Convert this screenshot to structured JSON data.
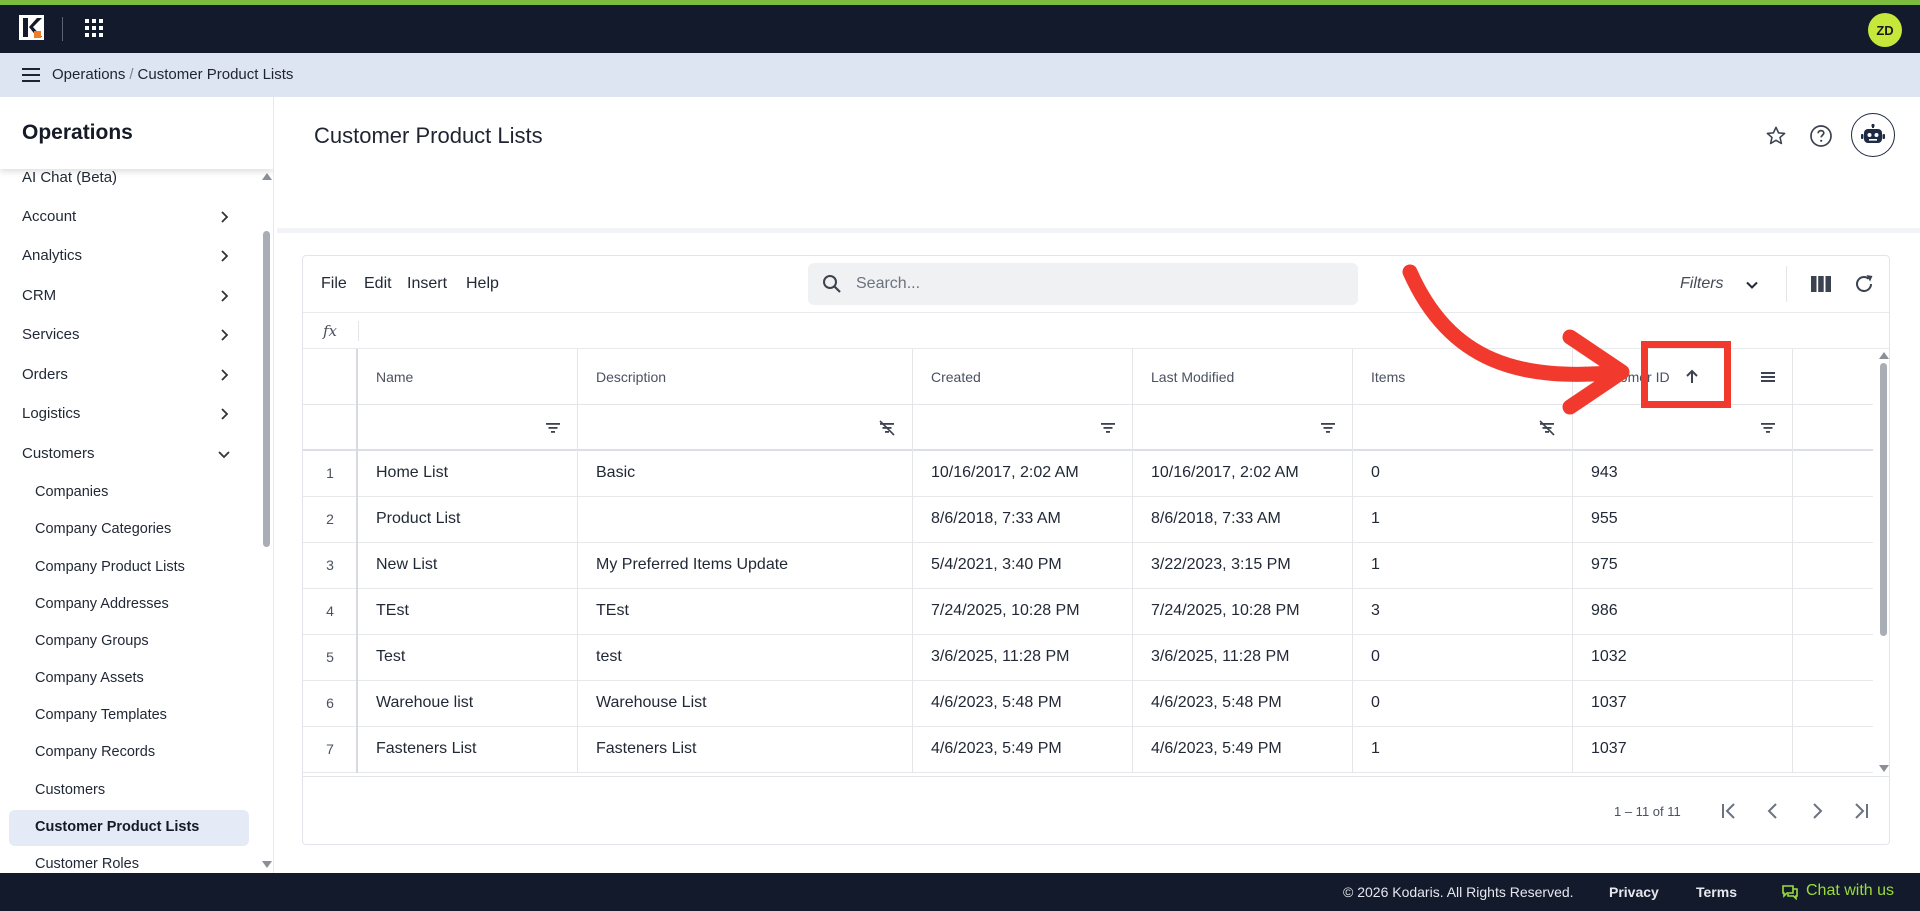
{
  "topbar": {
    "avatar_initials": "ZD",
    "accent": "#7dbb3f"
  },
  "breadcrumb": {
    "items": [
      "Operations",
      "Customer Product Lists"
    ]
  },
  "sidebar": {
    "title": "Operations",
    "items": [
      {
        "label": "AI Chat (Beta)"
      },
      {
        "label": "Account"
      },
      {
        "label": "Analytics"
      },
      {
        "label": "CRM"
      },
      {
        "label": "Services"
      },
      {
        "label": "Orders"
      },
      {
        "label": "Logistics"
      },
      {
        "label": "Customers"
      }
    ],
    "sub_items": [
      {
        "label": "Companies"
      },
      {
        "label": "Company Categories"
      },
      {
        "label": "Company Product Lists"
      },
      {
        "label": "Company Addresses"
      },
      {
        "label": "Company Groups"
      },
      {
        "label": "Company Assets"
      },
      {
        "label": "Company Templates"
      },
      {
        "label": "Company Records"
      },
      {
        "label": "Customers"
      },
      {
        "label": "Customer Product Lists"
      },
      {
        "label": "Customer Roles"
      }
    ]
  },
  "page": {
    "title": "Customer Product Lists"
  },
  "toolbar": {
    "menus": [
      "File",
      "Edit",
      "Insert",
      "Help"
    ],
    "search_placeholder": "Search...",
    "filters_label": "Filters",
    "fx_label": "fx"
  },
  "table": {
    "columns": [
      "Name",
      "Description",
      "Created",
      "Last Modified",
      "Items",
      "Customer ID"
    ],
    "sorted_column": "Customer ID",
    "sort_direction": "ascending",
    "rows": [
      [
        "1",
        "Home List",
        "Basic",
        "10/16/2017, 2:02 AM",
        "10/16/2017, 2:02 AM",
        "0",
        "943"
      ],
      [
        "2",
        "Product List",
        "",
        "8/6/2018, 7:33 AM",
        "8/6/2018, 7:33 AM",
        "1",
        "955"
      ],
      [
        "3",
        "New List",
        "My Preferred Items Update",
        "5/4/2021, 3:40 PM",
        "3/22/2023, 3:15 PM",
        "1",
        "975"
      ],
      [
        "4",
        "TEst",
        "TEst",
        "7/24/2025, 10:28 PM",
        "7/24/2025, 10:28 PM",
        "3",
        "986"
      ],
      [
        "5",
        "Test",
        "test",
        "3/6/2025, 11:28 PM",
        "3/6/2025, 11:28 PM",
        "0",
        "1032"
      ],
      [
        "6",
        "Warehoue list",
        "Warehouse List",
        "4/6/2023, 5:48 PM",
        "4/6/2023, 5:48 PM",
        "0",
        "1037"
      ],
      [
        "7",
        "Fasteners List",
        "Fasteners List",
        "4/6/2023, 5:49 PM",
        "4/6/2023, 5:49 PM",
        "1",
        "1037"
      ]
    ],
    "pagination": "1 – 11 of 11"
  },
  "footer": {
    "copyright": "© 2026 Kodaris. All Rights Reserved.",
    "privacy": "Privacy",
    "terms": "Terms",
    "chat": "Chat with us"
  },
  "annotation": {
    "color": "#f2392d"
  }
}
